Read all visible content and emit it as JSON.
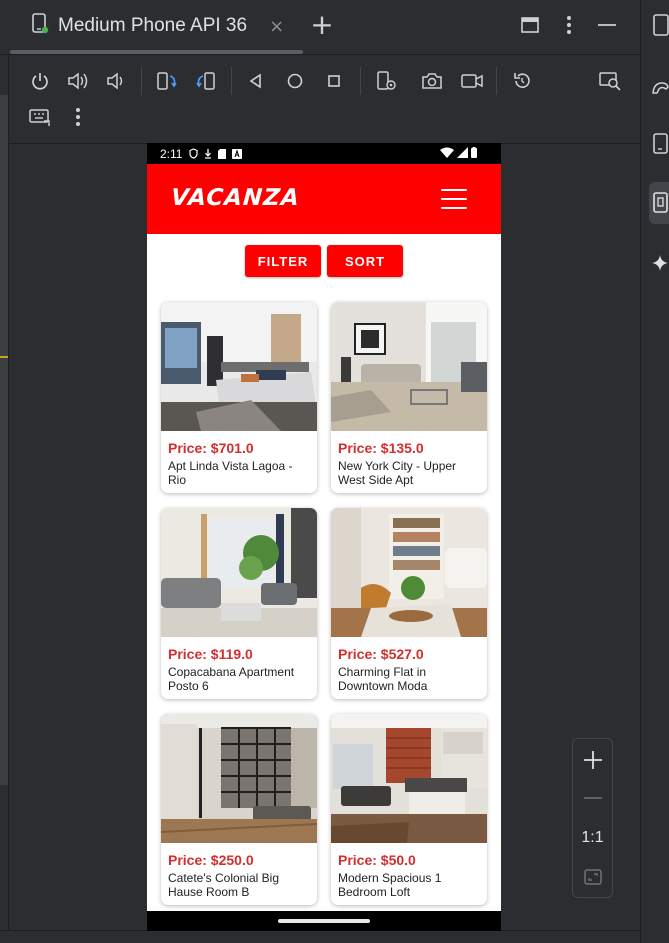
{
  "ide": {
    "tab_title": "Medium Phone API 36",
    "tab_close": "×",
    "tab_add": "+",
    "zoom": {
      "plus": "+",
      "minus": "—",
      "ratio": "1:1"
    }
  },
  "toolbar_icons": [
    "power-icon",
    "volume-up-icon",
    "volume-down-icon",
    "rotate-left-icon",
    "rotate-right-icon",
    "back-icon",
    "home-icon",
    "overview-icon",
    "device-settings-icon",
    "camera-icon",
    "screen-record-icon",
    "reset-icon",
    "screen-search-icon",
    "keyboard-icon",
    "more-icon"
  ],
  "phone": {
    "status": {
      "time": "2:11"
    },
    "app": {
      "logo": "VACANZA",
      "brand_color": "#ff0000",
      "price_color": "#d32f2f",
      "filter_label": "FILTER",
      "sort_label": "SORT"
    },
    "listings": [
      {
        "price": "Price: $701.0",
        "name": "Apt Linda Vista Lagoa - Rio"
      },
      {
        "price": "Price: $135.0",
        "name": "New York City - Upper West Side Apt"
      },
      {
        "price": "Price: $119.0",
        "name": "Copacabana Apartment Posto 6"
      },
      {
        "price": "Price: $527.0",
        "name": "Charming Flat in Downtown Moda"
      },
      {
        "price": "Price: $250.0",
        "name": "Catete's Colonial Big Hause Room B"
      },
      {
        "price": "Price: $50.0",
        "name": "Modern Spacious 1 Bedroom Loft"
      }
    ]
  }
}
